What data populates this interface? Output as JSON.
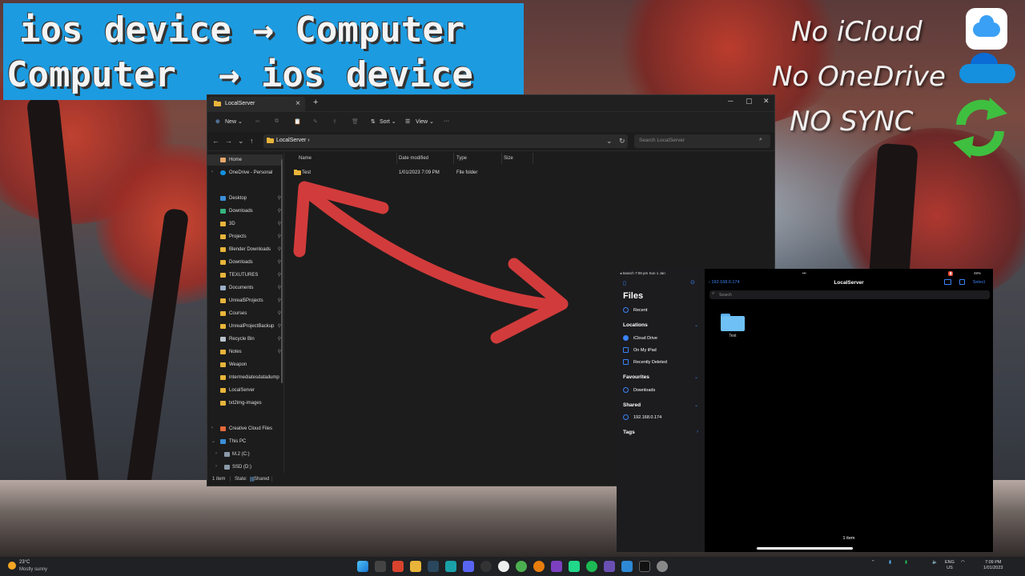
{
  "banner": {
    "line1": "ios device → Computer",
    "line2": "Computer  → ios device"
  },
  "claims": {
    "icloud": "No iCloud",
    "onedrive": "No OneDrive",
    "sync": "NO SYNC"
  },
  "explorer": {
    "tab_title": "LocalServer",
    "toolbar": {
      "new": "New ⌄",
      "sort": "Sort ⌄",
      "view": "View ⌄",
      "more": "···"
    },
    "address": "LocalServer  ›",
    "search_placeholder": "Search LocalServer",
    "nav": [
      {
        "label": "Home"
      },
      {
        "label": "OneDrive - Personal"
      },
      {
        "label": "Desktop",
        "pinned": "📌"
      },
      {
        "label": "Downloads",
        "pinned": "📌"
      },
      {
        "label": "3D",
        "pinned": "📌"
      },
      {
        "label": "Projects",
        "pinned": "📌"
      },
      {
        "label": "Blender Downloads",
        "pinned": "📌"
      },
      {
        "label": "Downloads",
        "pinned": "📌"
      },
      {
        "label": "TEXUTURES",
        "pinned": "📌"
      },
      {
        "label": "Documents",
        "pinned": "📌"
      },
      {
        "label": "Unreal5Projects",
        "pinned": "📌"
      },
      {
        "label": "Courses",
        "pinned": "📌"
      },
      {
        "label": "UnrealProjectBackup",
        "pinned": "📌"
      },
      {
        "label": "Recycle Bin",
        "pinned": "📌"
      },
      {
        "label": "Notes",
        "pinned": "📌"
      },
      {
        "label": "Weapon"
      },
      {
        "label": "intermediatesdatadump"
      },
      {
        "label": "LocalServer"
      },
      {
        "label": "txt2img-images"
      },
      {
        "label": "Creative Cloud Files"
      },
      {
        "label": "This PC"
      },
      {
        "label": "M.2 (C:)"
      },
      {
        "label": "SSD (D:)"
      }
    ],
    "columns": {
      "name": "Name",
      "date": "Date modified",
      "type": "Type",
      "size": "Size"
    },
    "rows": [
      {
        "name": "Test",
        "date": "1/01/2023 7:09 PM",
        "type": "File folder",
        "size": ""
      }
    ],
    "status": {
      "count": "1 item",
      "state": "State:",
      "shared": "Shared"
    }
  },
  "ipad": {
    "status_left": "◂ Search  7:09 pm  Sun 1 Jan",
    "status_right": "49%",
    "sidebar_title": "Files",
    "recent": "Recent",
    "locations_header": "Locations",
    "locations": [
      "iCloud Drive",
      "On My iPad",
      "Recently Deleted"
    ],
    "favourites_header": "Favourites",
    "favourites": [
      "Downloads"
    ],
    "shared_header": "Shared",
    "shared": [
      "192.168.0.174"
    ],
    "tags_header": "Tags",
    "back_label": "192.168.0.174",
    "title": "LocalServer",
    "select_label": "Select",
    "search_placeholder": "Search",
    "folder_name": "Test",
    "item_count": "1 item"
  },
  "taskbar": {
    "temp": "23°C",
    "weather": "Mostly sunny",
    "lang1": "ENG",
    "lang2": "US",
    "time": "7:09 PM",
    "date": "1/01/2023"
  },
  "colors": {
    "banner": "#1c9be0",
    "arrow": "#d23b3b",
    "ios_accent": "#3a82f7",
    "folder": "#e9b43a"
  }
}
